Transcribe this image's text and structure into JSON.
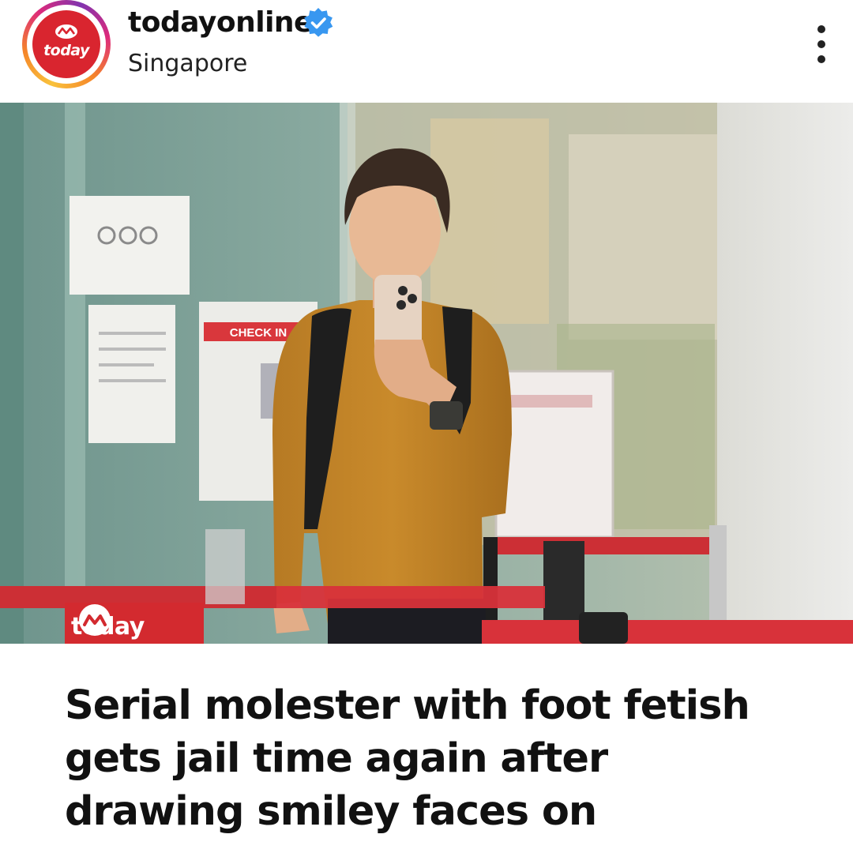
{
  "post": {
    "username": "todayonline",
    "verified": true,
    "location": "Singapore",
    "avatar_text": "today",
    "avatar_color": "#d9252f",
    "more_icon": "more-vertical-icon"
  },
  "photo": {
    "badge_text": "today",
    "badge_color": "#d32a2f",
    "sign_text": "CHECK IN"
  },
  "headline": {
    "lines": [
      "Serial molester with foot fetish",
      "gets jail time again after",
      "drawing smiley faces on"
    ]
  }
}
